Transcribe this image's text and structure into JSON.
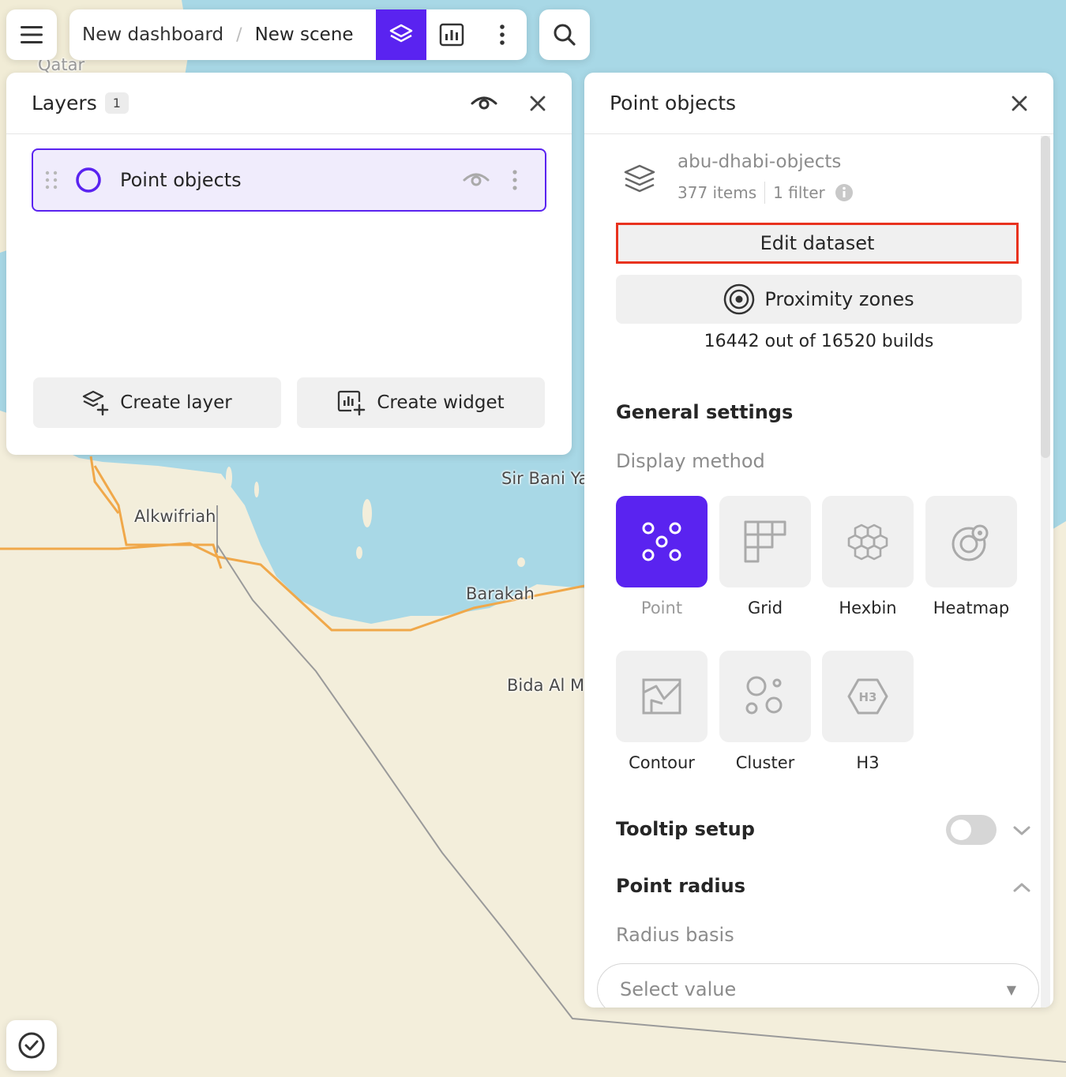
{
  "topbar": {
    "menu_icon": "hamburger-menu-icon",
    "breadcrumb": {
      "dashboard": "New dashboard",
      "separator": "/",
      "scene": "New scene"
    },
    "tools": [
      "layers-icon",
      "chart-widget-icon",
      "more-vertical-icon"
    ],
    "search_icon": "search-icon"
  },
  "map": {
    "labels": [
      "Qatar",
      "Alkwifriah",
      "Sir Bani Ya",
      "Barakah",
      "Bida Al M"
    ]
  },
  "layers_panel": {
    "title": "Layers",
    "count": "1",
    "items": [
      {
        "name": "Point objects"
      }
    ],
    "create_layer": "Create layer",
    "create_widget": "Create widget"
  },
  "props_panel": {
    "title": "Point objects",
    "dataset": {
      "name": "abu-dhabi-objects",
      "items": "377 items",
      "filter": "1 filter"
    },
    "edit_dataset": "Edit dataset",
    "proximity_zones": "Proximity zones",
    "builds": "16442 out of 16520 builds",
    "general_settings": "General settings",
    "display_method_label": "Display method",
    "display_methods": [
      {
        "label": "Point",
        "icon": "point-method-icon",
        "active": true
      },
      {
        "label": "Grid",
        "icon": "grid-method-icon",
        "active": false
      },
      {
        "label": "Hexbin",
        "icon": "hexbin-method-icon",
        "active": false
      },
      {
        "label": "Heatmap",
        "icon": "heatmap-method-icon",
        "active": false
      },
      {
        "label": "Contour",
        "icon": "contour-method-icon",
        "active": false
      },
      {
        "label": "Cluster",
        "icon": "cluster-method-icon",
        "active": false
      },
      {
        "label": "H3",
        "icon": "h3-method-icon",
        "active": false
      }
    ],
    "tooltip_setup": "Tooltip setup",
    "tooltip_enabled": false,
    "point_radius": "Point radius",
    "radius_basis_label": "Radius basis",
    "radius_select_placeholder": "Select value"
  },
  "colors": {
    "accent": "#5a23f0",
    "highlight": "#e8321e",
    "water": "#a8d8e6",
    "land": "#f3eedb",
    "road": "#f0a84a"
  }
}
